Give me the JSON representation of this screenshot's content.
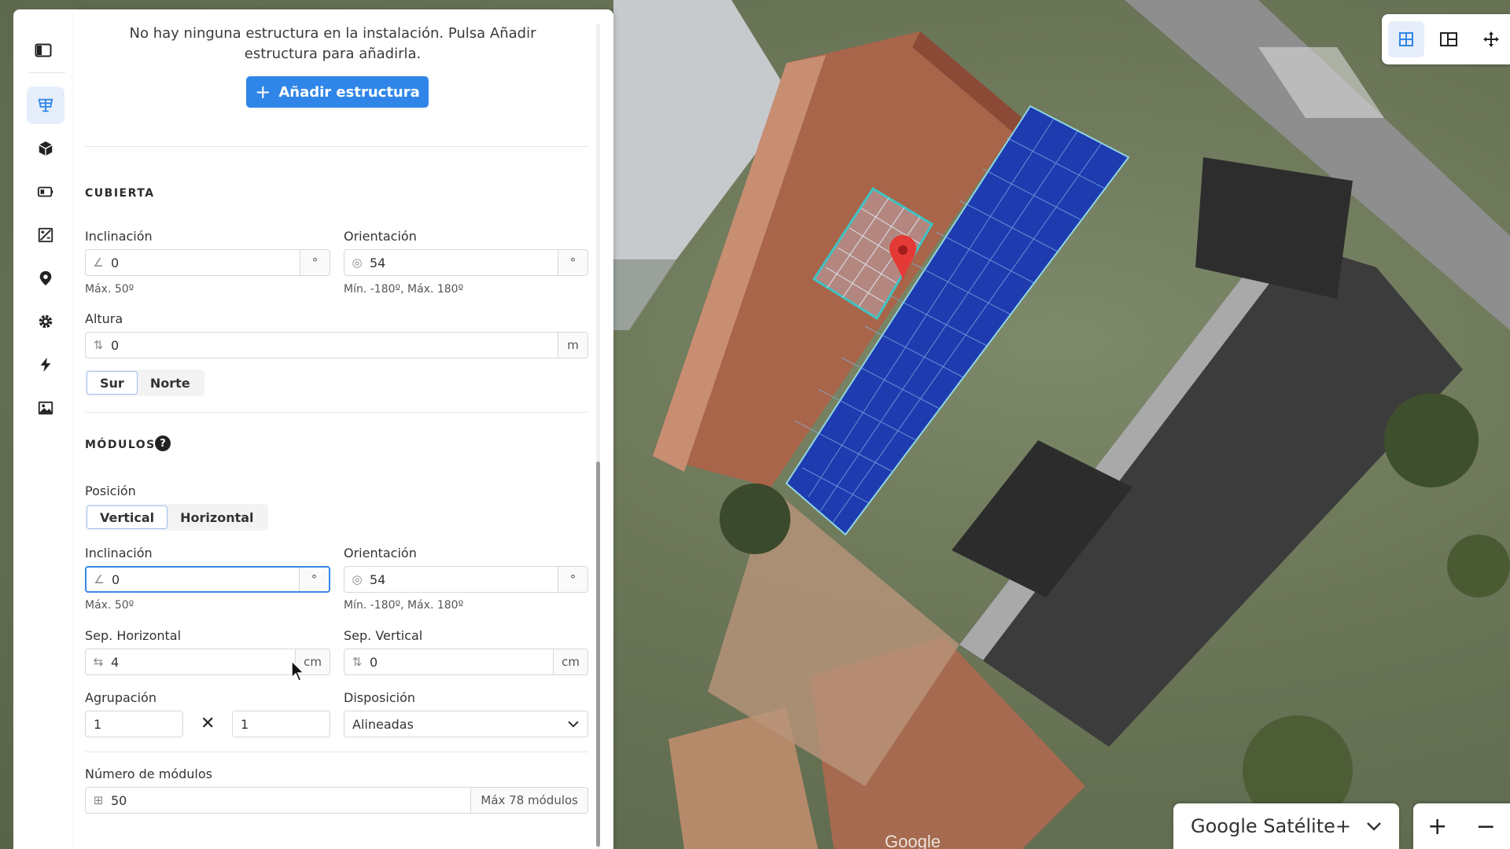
{
  "panel": {
    "empty_message": "No hay ninguna estructura en la instalación. Pulsa Añadir estructura para añadirla.",
    "add_button": "Añadir estructura"
  },
  "sidebar": {
    "items": [
      {
        "icon": "solar-panel-icon",
        "active": true
      },
      {
        "icon": "cube-icon",
        "active": false
      },
      {
        "icon": "battery-icon",
        "active": false
      },
      {
        "icon": "calculator-icon",
        "active": false
      },
      {
        "icon": "location-pin-icon",
        "active": false
      },
      {
        "icon": "gear-icon",
        "active": false
      },
      {
        "icon": "lightning-icon",
        "active": false
      },
      {
        "icon": "image-icon",
        "active": false
      }
    ]
  },
  "cubierta": {
    "title": "CUBIERTA",
    "inclinacion_label": "Inclinación",
    "inclinacion_value": "0",
    "inclinacion_unit": "°",
    "inclinacion_hint": "Máx. 50º",
    "orientacion_label": "Orientación",
    "orientacion_value": "54",
    "orientacion_unit": "°",
    "orientacion_hint": "Mín. -180º, Máx. 180º",
    "altura_label": "Altura",
    "altura_value": "0",
    "altura_unit": "m",
    "sur_label": "Sur",
    "norte_label": "Norte"
  },
  "modulos": {
    "title": "MÓDULOS",
    "help": "?",
    "posicion_label": "Posición",
    "vertical_label": "Vertical",
    "horizontal_label": "Horizontal",
    "inclinacion_label": "Inclinación",
    "inclinacion_value": "0",
    "inclinacion_unit": "°",
    "inclinacion_hint": "Máx. 50º",
    "orientacion_label": "Orientación",
    "orientacion_value": "54",
    "orientacion_unit": "°",
    "orientacion_hint": "Mín. -180º, Máx. 180º",
    "sep_h_label": "Sep. Horizontal",
    "sep_h_value": "4",
    "sep_h_unit": "cm",
    "sep_v_label": "Sep. Vertical",
    "sep_v_value": "0",
    "sep_v_unit": "cm",
    "agrupacion_label": "Agrupación",
    "agrupacion_a": "1",
    "agrupacion_b": "1",
    "disposicion_label": "Disposición",
    "disposicion_value": "Alineadas",
    "numero_label": "Número de módulos",
    "numero_value": "50",
    "numero_max": "Máx 78 módulos"
  },
  "map": {
    "layer": "Google Satélite+",
    "zoom_in": "+",
    "zoom_out": "−",
    "tools": [
      "grid-view-icon",
      "layout-icon",
      "move-icon"
    ],
    "watermark": "Google"
  },
  "colors": {
    "accent": "#2f86e8",
    "panel_blue": "#1f3bb0",
    "outline_cyan": "#3fc3c3",
    "marker_red": "#e53935"
  }
}
